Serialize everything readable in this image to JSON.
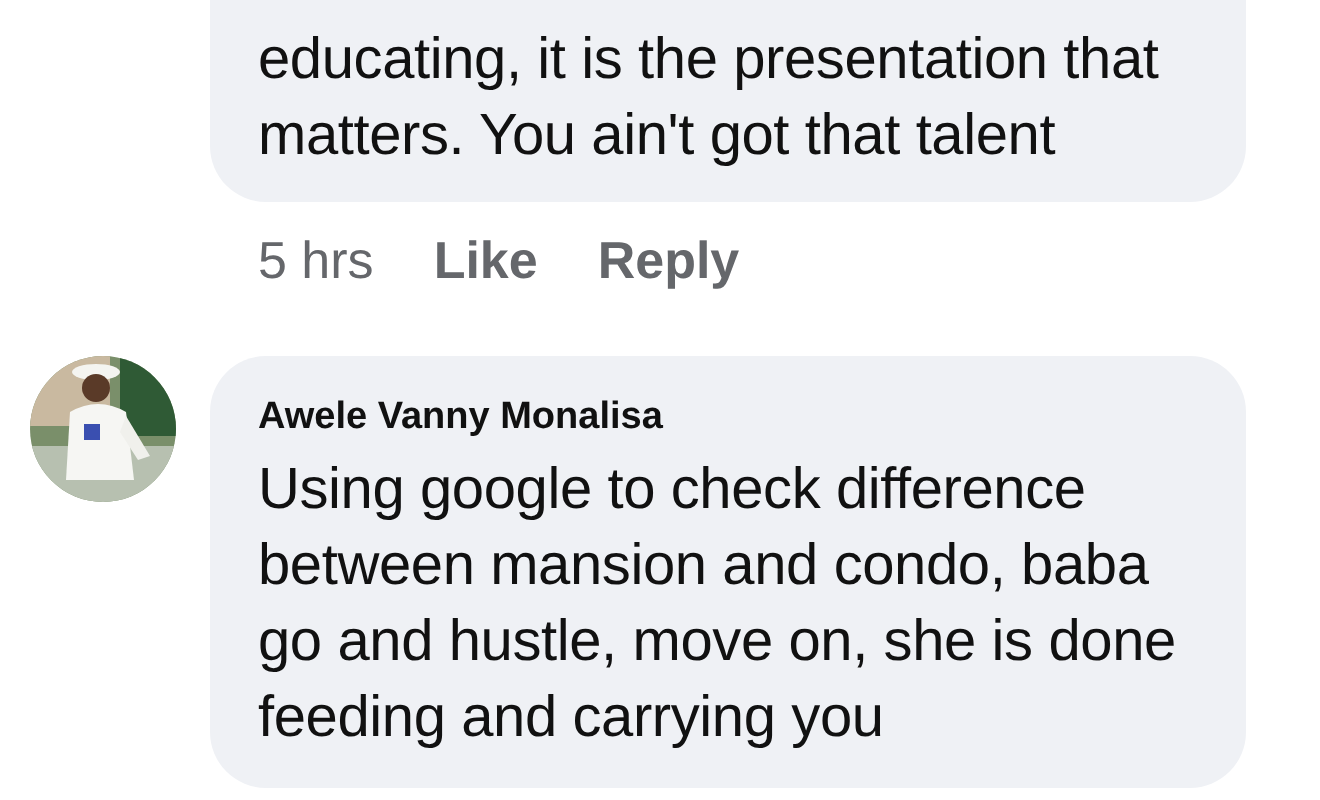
{
  "comments": [
    {
      "kind": "cut",
      "text": "educating, it is the presentation that matters. You ain't got that talent",
      "time": "5 hrs",
      "actions": [
        "Like",
        "Reply"
      ]
    },
    {
      "kind": "full",
      "author": "Awele Vanny Monalisa",
      "text": "Using google to check difference between mansion and condo, baba go and hustle, move on, she is done feeding and carrying you"
    }
  ]
}
